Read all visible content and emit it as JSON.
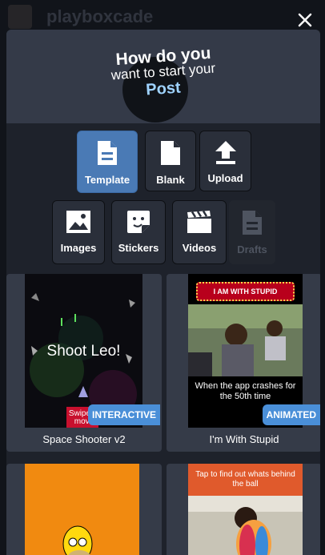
{
  "background": {
    "app_name": "playboxcade"
  },
  "header": {
    "line1": "How do you",
    "line2": "want to start your",
    "line3": "Post"
  },
  "buttons": [
    {
      "label": "Template",
      "icon": "document-icon"
    },
    {
      "label": "Blank",
      "icon": "blank-page-icon"
    },
    {
      "label": "Upload",
      "icon": "upload-icon"
    },
    {
      "label": "Images",
      "icon": "image-icon"
    },
    {
      "label": "Stickers",
      "icon": "sticker-icon"
    },
    {
      "label": "Videos",
      "icon": "clapperboard-icon"
    },
    {
      "label": "Drafts",
      "icon": "drafts-icon"
    }
  ],
  "templates": [
    {
      "title": "Space Shooter v2",
      "badge": "INTERACTIVE",
      "thumb_text": "Shoot Leo!",
      "thumb_small": "Swipe to move"
    },
    {
      "title": "I'm With Stupid",
      "badge": "ANIMATED",
      "thumb_banner": "I AM WITH STUPID",
      "thumb_caption": "When the app crashes for the 50th time"
    },
    {
      "title": "",
      "badge": ""
    },
    {
      "title": "",
      "badge": "",
      "thumb_banner": "Tap to find out whats behind the ball"
    }
  ],
  "colors": {
    "accent": "#4a7ab5",
    "badge": "#4a8fd8",
    "card": "#353b48",
    "modal": "#1e222b"
  }
}
